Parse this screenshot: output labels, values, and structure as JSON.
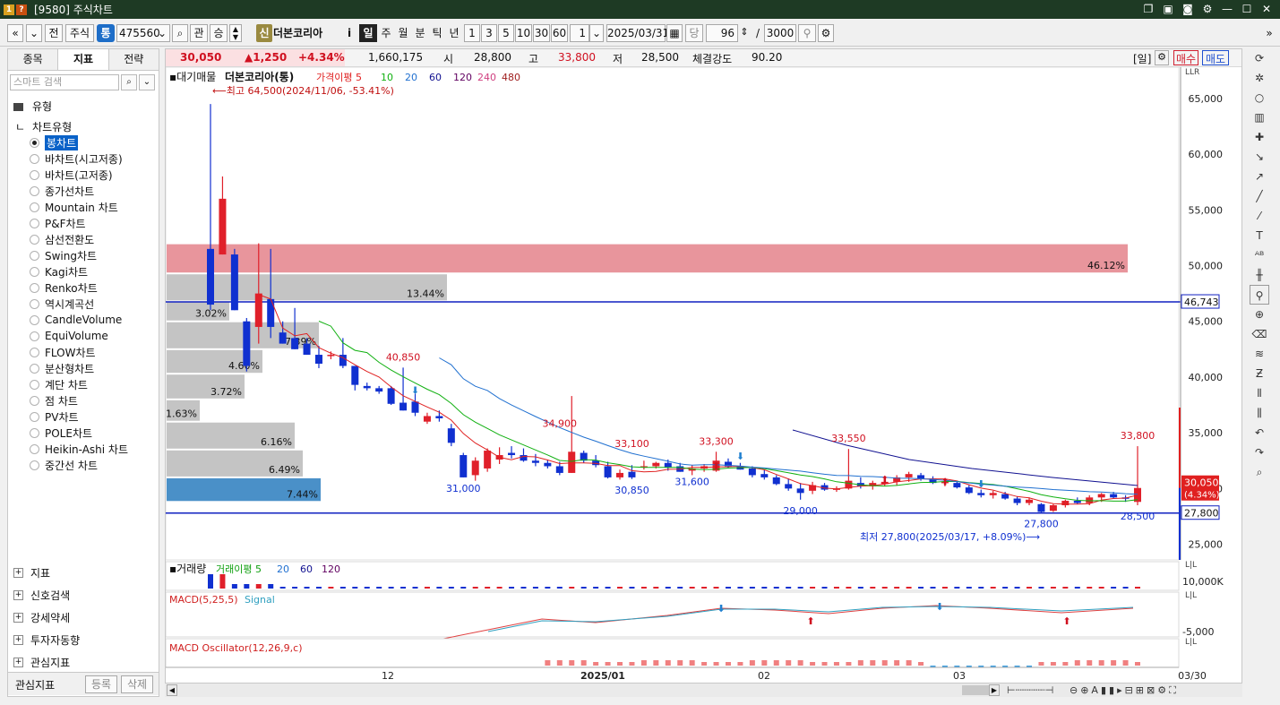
{
  "window": {
    "title": "[9580] 주식차트"
  },
  "toolbar": {
    "market": "주식",
    "type_badge": "통",
    "code": "475560",
    "btn_gwan": "관",
    "btn_seung": "승",
    "new_badge": "신",
    "stock_name": "더본코리아",
    "info_btn": "i",
    "periods": [
      "일",
      "주",
      "월",
      "분",
      "틱",
      "년"
    ],
    "minutes": [
      "1",
      "3",
      "5",
      "10",
      "30",
      "60"
    ],
    "period_num": "1",
    "date": "2025/03/31",
    "dang": "당",
    "count": "96",
    "total": "3000"
  },
  "left_panel": {
    "tabs": [
      "종목",
      "지표",
      "전략"
    ],
    "search_placeholder": "스마트 검색",
    "group_label": "유형",
    "tree_root": "차트유형",
    "chart_types": [
      "봉차트",
      "바차트(시고저종)",
      "바차트(고저종)",
      "종가선차트",
      "Mountain 차트",
      "P&F차트",
      "삼선전환도",
      "Swing차트",
      "Kagi차트",
      "Renko차트",
      "역시계곡선",
      "CandleVolume",
      "EquiVolume",
      "FLOW차트",
      "분산형차트",
      "계단 차트",
      "점 차트",
      "PV차트",
      "POLE차트",
      "Heikin-Ashi 차트",
      "중간선 차트"
    ],
    "lower_groups": [
      "지표",
      "신호검색",
      "강세약세",
      "투자자동향",
      "관심지표"
    ],
    "footer_label": "관심지표",
    "footer_register": "등록",
    "footer_delete": "삭제"
  },
  "quote": {
    "price": "30,050",
    "change": "▲1,250",
    "change_pct": "+4.34%",
    "volume": "1,660,175",
    "open_label": "시",
    "open": "28,800",
    "high_label": "고",
    "high": "33,800",
    "low_label": "저",
    "low": "28,500",
    "strength_label": "체결강도",
    "strength": "90.20",
    "period_tag": "[일]",
    "buy": "매수",
    "sell": "매도"
  },
  "legend": {
    "prefix": "대기매물",
    "name": "더본코리아(통)",
    "ma_label": "가격이평 5",
    "ma": [
      "10",
      "20",
      "60",
      "120",
      "240",
      "480"
    ],
    "top_note": "⟵최고 64,500(2024/11/06, -53.41%)",
    "bottom_note": "최저 27,800(2025/03/17, +8.09%)⟶"
  },
  "panes": {
    "volume_label": "거래량",
    "volume_ma": [
      "거래이평 5",
      "20",
      "60",
      "120"
    ],
    "volume_axis": "10,000K",
    "macd_label": "MACD(5,25,5)",
    "macd_signal": "Signal",
    "macd_axis": "-5,000",
    "osc_label": "MACD Oscillator(12,26,9,c)",
    "llr": "LLR",
    "lil": "L|L"
  },
  "colors": {
    "up": "#e0202a",
    "down": "#1030d0",
    "ma5": "#e02020",
    "ma10": "#10b010",
    "ma20": "#2070d0",
    "ma60": "#101090",
    "vp_gray": "#c4c4c4",
    "vp_pink": "#e8959c",
    "vp_blue": "#4a90c8"
  },
  "chart_data": {
    "type": "candlestick",
    "price_axis": {
      "ticks": [
        65000,
        60000,
        55000,
        50000,
        45000,
        40000,
        35000,
        30000,
        25000
      ]
    },
    "x_labels": [
      "12",
      "2025/01",
      "02",
      "03",
      "03/30"
    ],
    "current_price": "30,050",
    "current_pct": "(4.34%)",
    "line_46743": "46,743",
    "line_27800": "27,800",
    "price_labels": [
      "40,850",
      "34,900",
      "31,000",
      "33,100",
      "30,850",
      "33,300",
      "31,600",
      "33,550",
      "29,000",
      "27,800",
      "33,800",
      "28,500"
    ],
    "volume_profile": [
      "46.12%",
      "13.44%",
      "3.02%",
      "7.39%",
      "4.60%",
      "3.72%",
      "1.63%",
      "6.16%",
      "6.49%",
      "7.44%"
    ],
    "candles": [
      [
        51500,
        64500,
        46000,
        46500
      ],
      [
        51000,
        58000,
        51000,
        56000
      ],
      [
        51000,
        51500,
        46000,
        46000
      ],
      [
        45000,
        45300,
        40500,
        41000
      ],
      [
        44500,
        52000,
        43000,
        47500
      ],
      [
        47000,
        51500,
        43500,
        44500
      ],
      [
        44000,
        45000,
        43000,
        43000
      ],
      [
        43500,
        46200,
        42500,
        42500
      ],
      [
        43000,
        43500,
        42000,
        42000
      ],
      [
        42000,
        42800,
        40800,
        41200
      ],
      [
        42000,
        42300,
        41600,
        42000
      ],
      [
        42000,
        43500,
        40800,
        41000
      ],
      [
        41000,
        41000,
        38800,
        39300
      ],
      [
        39200,
        39500,
        38800,
        39000
      ],
      [
        39000,
        39200,
        38500,
        38700
      ],
      [
        39000,
        39200,
        37500,
        37600
      ],
      [
        37700,
        40850,
        37000,
        37000
      ],
      [
        37800,
        38500,
        36500,
        36800
      ],
      [
        36000,
        36800,
        35800,
        36500
      ],
      [
        36500,
        37000,
        36000,
        36300
      ],
      [
        35400,
        35800,
        33800,
        34100
      ],
      [
        33000,
        33200,
        31000,
        31000
      ],
      [
        31200,
        32800,
        30700,
        32500
      ],
      [
        31800,
        33600,
        31500,
        33400
      ],
      [
        32600,
        33700,
        32200,
        33000
      ],
      [
        33200,
        33800,
        32700,
        33000
      ],
      [
        33000,
        33600,
        32400,
        32500
      ],
      [
        32500,
        33100,
        32000,
        32300
      ],
      [
        32300,
        32600,
        31800,
        32000
      ],
      [
        32000,
        32400,
        31200,
        31400
      ],
      [
        31400,
        38300,
        31400,
        33300
      ],
      [
        33200,
        33400,
        32300,
        32500
      ],
      [
        32500,
        33000,
        31900,
        32100
      ],
      [
        32000,
        32400,
        30900,
        31000
      ],
      [
        31000,
        31700,
        30800,
        31400
      ],
      [
        31500,
        32100,
        30850,
        31000
      ],
      [
        32000,
        32500,
        31700,
        32000
      ],
      [
        32000,
        32400,
        31800,
        32300
      ],
      [
        32300,
        32600,
        31600,
        31900
      ],
      [
        32000,
        32300,
        31500,
        31500
      ],
      [
        31600,
        32100,
        31200,
        31800
      ],
      [
        31800,
        32200,
        31500,
        32000
      ],
      [
        31600,
        33300,
        31500,
        32500
      ],
      [
        32400,
        32700,
        31800,
        32000
      ],
      [
        32000,
        32300,
        31700,
        31700
      ],
      [
        31800,
        32000,
        31000,
        31200
      ],
      [
        31300,
        31700,
        30800,
        31000
      ],
      [
        31000,
        31200,
        30300,
        30400
      ],
      [
        30400,
        30900,
        29800,
        30000
      ],
      [
        30000,
        30500,
        29000,
        29600
      ],
      [
        29800,
        30600,
        29500,
        30300
      ],
      [
        30300,
        30500,
        29800,
        29900
      ],
      [
        30000,
        30200,
        29700,
        30000
      ],
      [
        30000,
        33550,
        29900,
        30700
      ],
      [
        30500,
        31000,
        30000,
        30200
      ],
      [
        30200,
        30700,
        29900,
        30500
      ],
      [
        30400,
        30900,
        30200,
        30600
      ],
      [
        30600,
        31200,
        30300,
        31000
      ],
      [
        31000,
        31500,
        30600,
        31300
      ],
      [
        31200,
        31400,
        30700,
        30900
      ],
      [
        30900,
        31100,
        30400,
        30500
      ],
      [
        30500,
        30900,
        30200,
        30600
      ],
      [
        30500,
        30700,
        30000,
        30100
      ],
      [
        30100,
        30300,
        29500,
        29600
      ],
      [
        29600,
        29900,
        29200,
        29400
      ],
      [
        29400,
        29800,
        29100,
        29600
      ],
      [
        29500,
        29700,
        29000,
        29100
      ],
      [
        29100,
        29300,
        28500,
        28700
      ],
      [
        28700,
        29200,
        28500,
        29000
      ],
      [
        28600,
        28700,
        27800,
        27900
      ],
      [
        28000,
        28600,
        27900,
        28500
      ],
      [
        28500,
        29000,
        28300,
        28900
      ],
      [
        28900,
        29200,
        28600,
        28700
      ],
      [
        28700,
        29400,
        28500,
        29200
      ],
      [
        29200,
        29600,
        28800,
        29500
      ],
      [
        29500,
        29700,
        29100,
        29200
      ],
      [
        29200,
        29400,
        28800,
        29100
      ],
      [
        28800,
        33800,
        28500,
        30050
      ]
    ]
  }
}
